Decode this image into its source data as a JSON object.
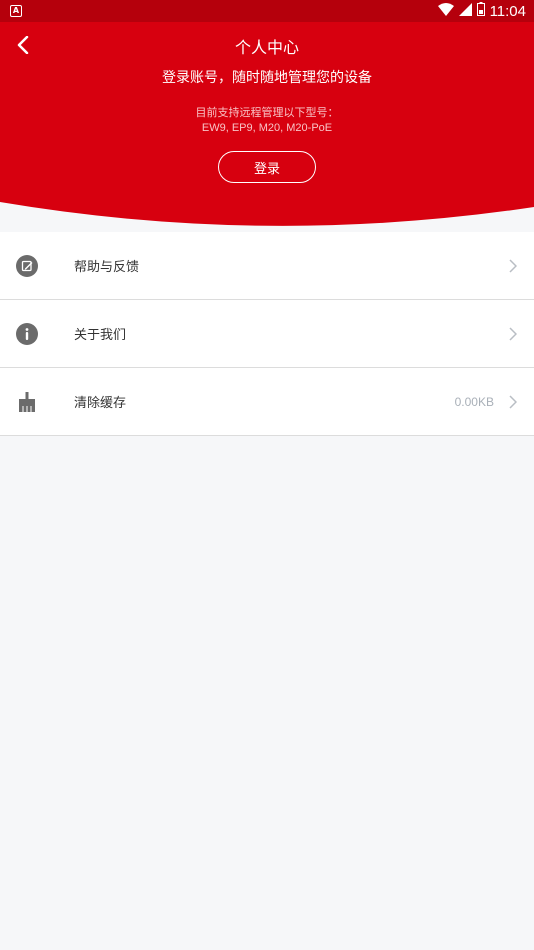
{
  "status_bar": {
    "notification_icon": "a-notification-icon",
    "wifi_icon": "wifi-icon",
    "signal_icon": "signal-icon",
    "battery_icon": "battery-icon",
    "time": "11:04"
  },
  "header": {
    "title": "个人中心",
    "subtitle": "登录账号，随时随地管理您的设备",
    "support_note": "目前支持远程管理以下型号：",
    "models": "EW9, EP9, M20, M20-PoE",
    "login_label": "登录",
    "back_icon": "back-arrow-icon"
  },
  "menu": {
    "items": [
      {
        "label": "帮助与反馈",
        "icon": "edit-feedback-icon",
        "value": ""
      },
      {
        "label": "关于我们",
        "icon": "info-icon",
        "value": ""
      },
      {
        "label": "清除缓存",
        "icon": "broom-icon",
        "value": "0.00KB"
      }
    ]
  },
  "colors": {
    "brand_red": "#d7000f",
    "status_bar": "#b5000c",
    "background": "#f6f7f9",
    "icon_gray": "#6b6b6b"
  }
}
